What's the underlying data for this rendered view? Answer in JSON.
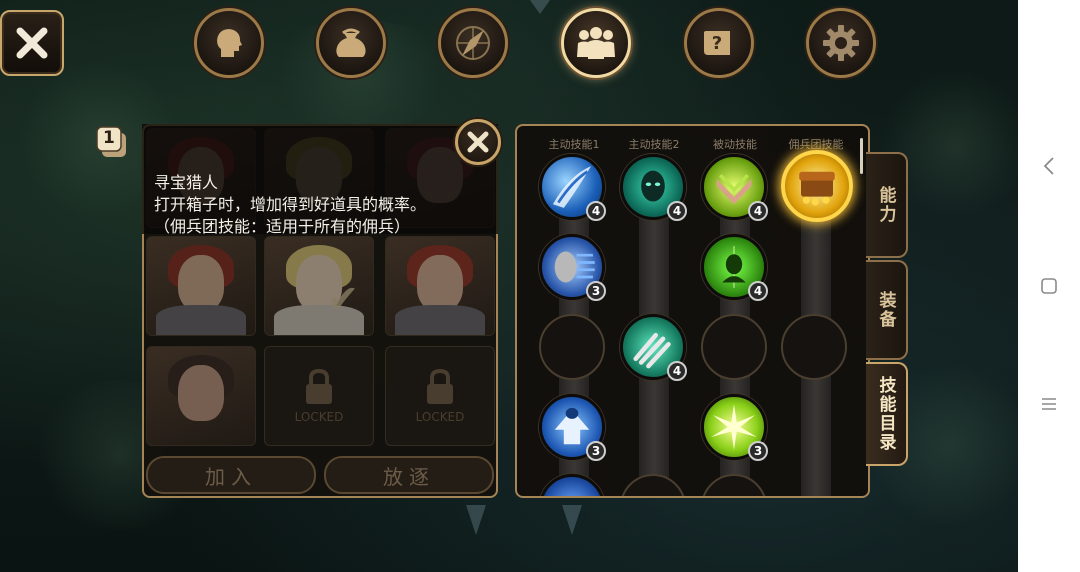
{
  "top_menu": [
    {
      "name": "character-icon",
      "active": false
    },
    {
      "name": "inventory-bag-icon",
      "active": false
    },
    {
      "name": "compass-icon",
      "active": false
    },
    {
      "name": "mercenaries-icon",
      "active": true
    },
    {
      "name": "quest-scroll-icon",
      "active": false
    },
    {
      "name": "settings-gear-icon",
      "active": false
    }
  ],
  "tooltip": {
    "title": "寻宝猎人",
    "description": "打开箱子时，增加得到好道具的概率。",
    "note": "（佣兵团技能：适用于所有的佣兵）"
  },
  "party": {
    "badge": "1",
    "locked_label_1": "LOCKED",
    "locked_label_2": "LOCKED",
    "join_button": "加入",
    "dismiss_button": "放逐"
  },
  "skill_tree": {
    "headers": [
      "主动技能1",
      "主动技能2",
      "被动技能",
      "佣兵团技能"
    ],
    "levels": {
      "r1c1": "4",
      "r1c2": "4",
      "r1c3": "4",
      "r2c1": "3",
      "r2c3": "4",
      "r3c2": "4",
      "r4c1": "3",
      "r4c3": "3"
    }
  },
  "side_tabs": {
    "ability": "能力",
    "equipment": "装备",
    "skill_list": "技能目录"
  },
  "colors": {
    "frame_gold": "#a58455",
    "selected_glow": "#ffd54a",
    "tooltip_text": "#f4f0e8"
  }
}
